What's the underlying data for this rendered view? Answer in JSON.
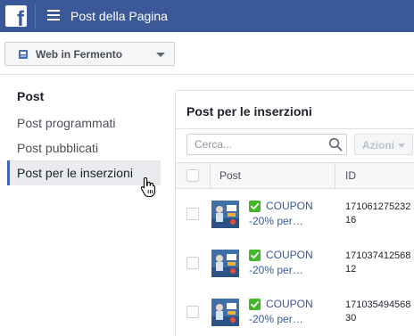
{
  "topbar": {
    "logo_letter": "f",
    "title": "Post della Pagina",
    "icons": {
      "logo": "facebook-logo-icon",
      "menu": "hamburger-menu-icon"
    },
    "color": "#3b5998"
  },
  "page_selector": {
    "label": "Web in Fermento",
    "icon": "page-flag-icon"
  },
  "sidebar": {
    "heading": "Post",
    "items": [
      {
        "label": "Post programmati",
        "active": false
      },
      {
        "label": "Post pubblicati",
        "active": false
      },
      {
        "label": "Post per le inserzioni",
        "active": true
      }
    ],
    "accent": "#4267b2"
  },
  "panel": {
    "title": "Post per le inserzioni",
    "search": {
      "placeholder": "Cerca...",
      "value": ""
    },
    "actions_label": "Azioni",
    "columns": [
      "Post",
      "ID"
    ],
    "rows": [
      {
        "title": "COUPON",
        "subtitle": "-20% per…",
        "id_line1": "171061275232",
        "id_line2": "16"
      },
      {
        "title": "COUPON",
        "subtitle": "-20% per…",
        "id_line1": "171037412568",
        "id_line2": "12"
      },
      {
        "title": "COUPON",
        "subtitle": "-20% per…",
        "id_line1": "171035494568",
        "id_line2": "30"
      }
    ],
    "link_color": "#365899",
    "badge_color": "#42b72a"
  }
}
